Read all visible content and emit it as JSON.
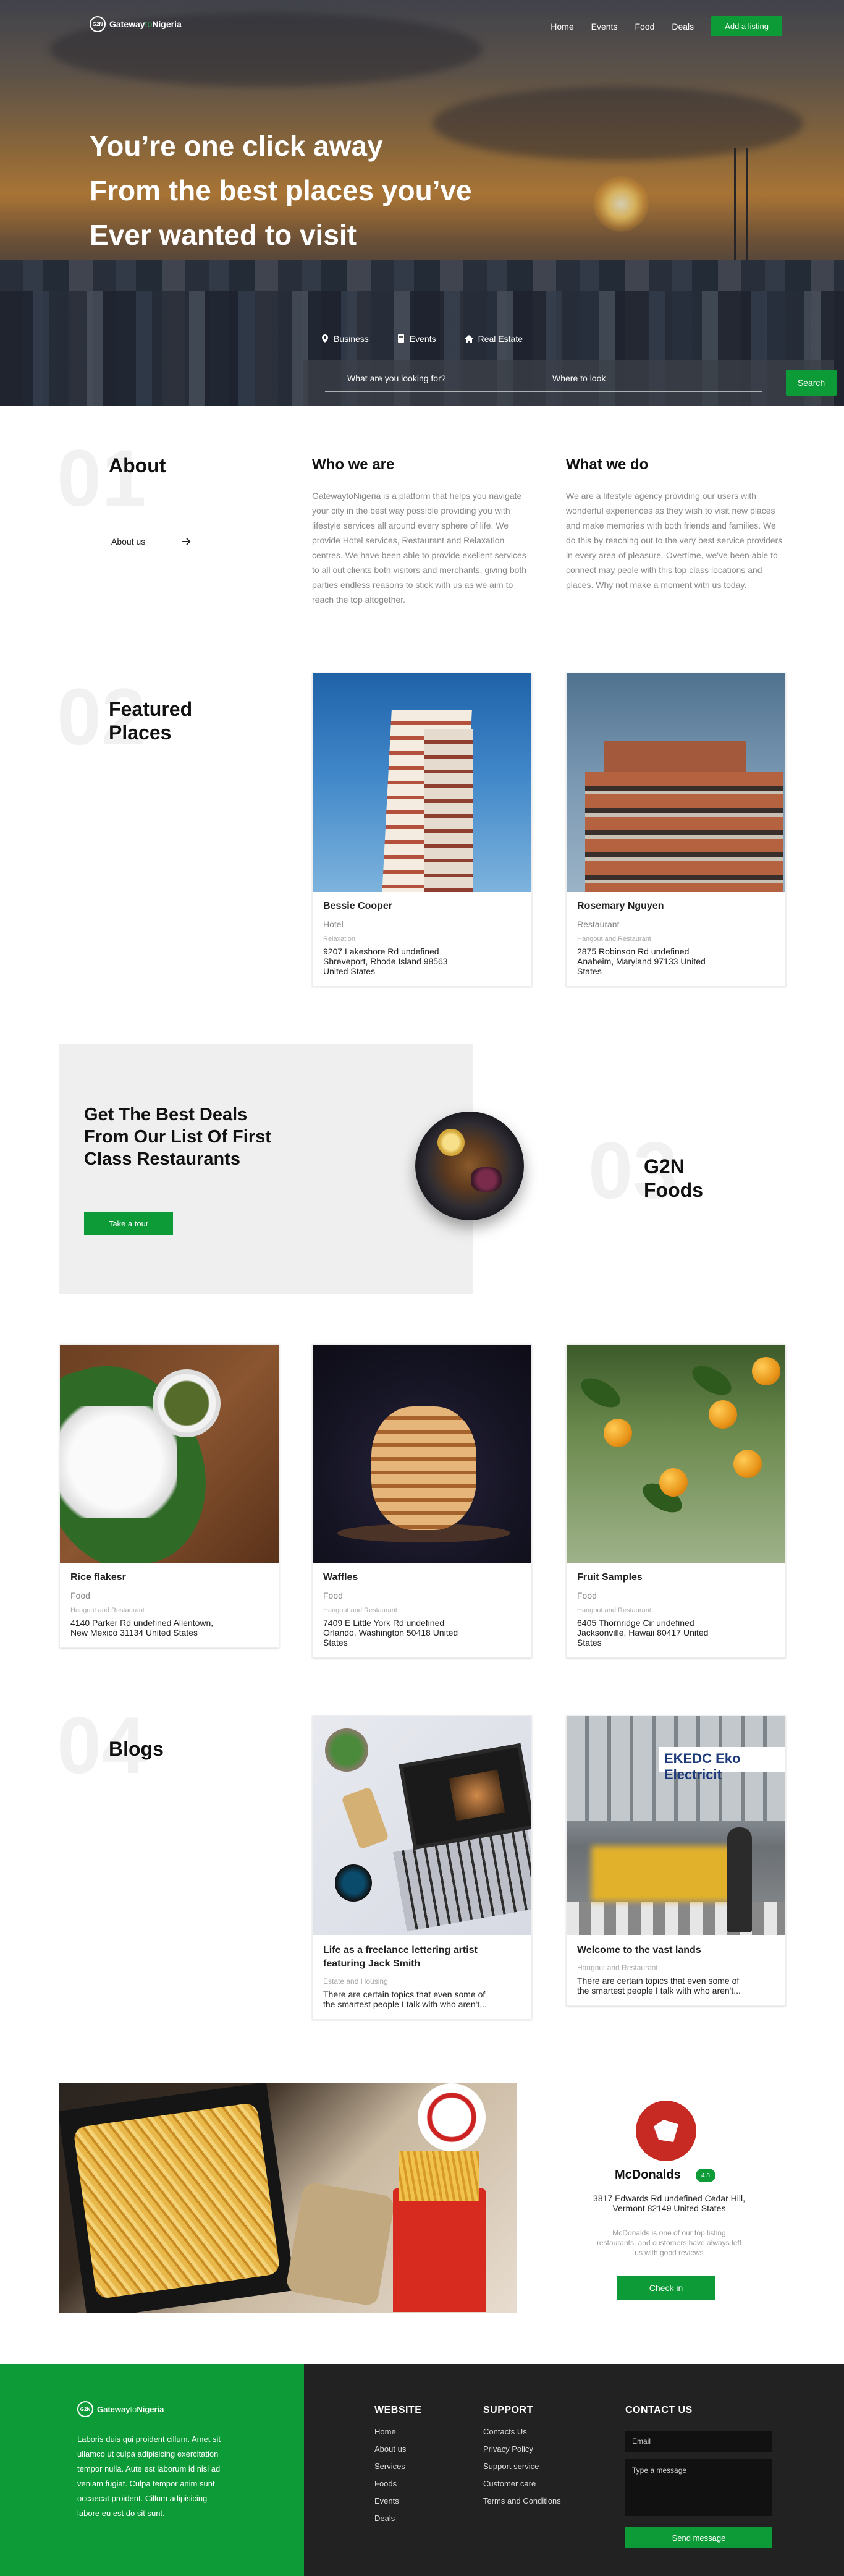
{
  "nav": {
    "logo_prefix": "Gateway",
    "logo_to": "to",
    "logo_suffix": "Nigeria",
    "logo_badge": "G2N",
    "links": [
      "Home",
      "Events",
      "Food",
      "Deals"
    ],
    "cta": "Add a listing"
  },
  "hero": {
    "lines": [
      "You’re one click away",
      "From the best places you’ve",
      "Ever wanted to visit"
    ],
    "tabs": [
      {
        "icon": "pin-icon",
        "label": "Business"
      },
      {
        "icon": "ticket-icon",
        "label": "Events"
      },
      {
        "icon": "home-icon",
        "label": "Real Estate"
      }
    ],
    "search_what": "What are you looking for?",
    "search_where": "Where to look",
    "search_button": "Search"
  },
  "about": {
    "num": "01",
    "title": "About",
    "link": "About us",
    "who_title": "Who we are",
    "who_text": "GatewaytoNigeria is a platform that helps you navigate your city in the best way possible providing you with lifestyle services all around every sphere of life. We provide Hotel services, Restaurant and Relaxation centres. We have been able to provide exellent services to all out clients both visitors and merchants, giving both parties endless reasons to stick with us as we aim to reach the top altogether.",
    "what_title": "What we do",
    "what_text": "We are a lifestyle agency providing our users with wonderful experiences as they wish to visit new places and make memories with both friends and families. We do this by reaching out to the very best service providers in every area of pleasure. Overtime, we've been able to connect may peole with this top class locations and places. Why not make a moment with us today."
  },
  "featured": {
    "num": "02",
    "title_line1": "Featured",
    "title_line2": "Places",
    "cards": [
      {
        "name": "Bessie Cooper",
        "category": "Hotel",
        "sub": "Relaxation",
        "address": "9207 Lakeshore Rd undefined Shreveport, Rhode Island 98563 United States"
      },
      {
        "name": "Rosemary Nguyen",
        "category": "Restaurant",
        "sub": "Hangout and Restaurant",
        "address": "2875 Robinson Rd undefined Anaheim, Maryland 97133 United States"
      }
    ]
  },
  "deals": {
    "title": "Get The Best Deals From Our List Of First Class Restaurants",
    "button": "Take a tour",
    "num": "03",
    "side_line1": "G2N",
    "side_line2": "Foods"
  },
  "foods": [
    {
      "name": "Rice flakesr",
      "category": "Food",
      "sub": "Hangout and Restaurant",
      "address": "4140 Parker Rd undefined Allentown, New Mexico 31134 United States"
    },
    {
      "name": "Waffles",
      "category": "Food",
      "sub": "Hangout and Restaurant",
      "address": "7409 E Little York Rd undefined Orlando, Washington 50418 United States"
    },
    {
      "name": "Fruit Samples",
      "category": "Food",
      "sub": "Hangout and Restaurant",
      "address": "6405 Thornridge Cir undefined Jacksonville, Hawaii 80417 United States"
    }
  ],
  "blogs": {
    "num": "04",
    "title": "Blogs",
    "cards": [
      {
        "title": "Life as a freelance lettering artist featuring Jack Smith",
        "sub": "Estate and Housing",
        "text": "There are certain topics that even some of the smartest people I talk with who aren't..."
      },
      {
        "title": "Welcome to the vast lands",
        "sub": "Hangout and Restaurant",
        "text": "There are certain topics that even some of the smartest people I talk with who aren't..."
      }
    ],
    "street_sign": "EKEDC Eko Electricit"
  },
  "promo": {
    "name": "McDonalds",
    "badge": "4.8",
    "address": "3817 Edwards Rd undefined Cedar Hill, Vermont 82149 United States",
    "desc": "McDonalds is one of our top listing restaurants, and customers have always left us with good reviews",
    "button": "Check in"
  },
  "footer": {
    "text": "Laboris duis qui proident cillum. Amet sit ullamco ut culpa adipisicing exercitation tempor nulla. Aute est laborum id nisi ad veniam fugiat. Culpa tempor anim sunt occaecat proident. Cillum adipisicing labore eu est do sit sunt.",
    "website_title": "WEBSITE",
    "website_links": [
      "Home",
      "About us",
      "Services",
      "Foods",
      "Events",
      "Deals"
    ],
    "support_title": "SUPPORT",
    "support_links": [
      "Contacts Us",
      "Privacy Policy",
      "Support service",
      "Customer care",
      "Terms and Conditions"
    ],
    "contact_title": "CONTACT US",
    "email_placeholder": "Email",
    "message_placeholder": "Type a message",
    "send_button": "Send message"
  },
  "colors": {
    "brand_green": "#0c9b36",
    "footer_dark": "#222222"
  }
}
